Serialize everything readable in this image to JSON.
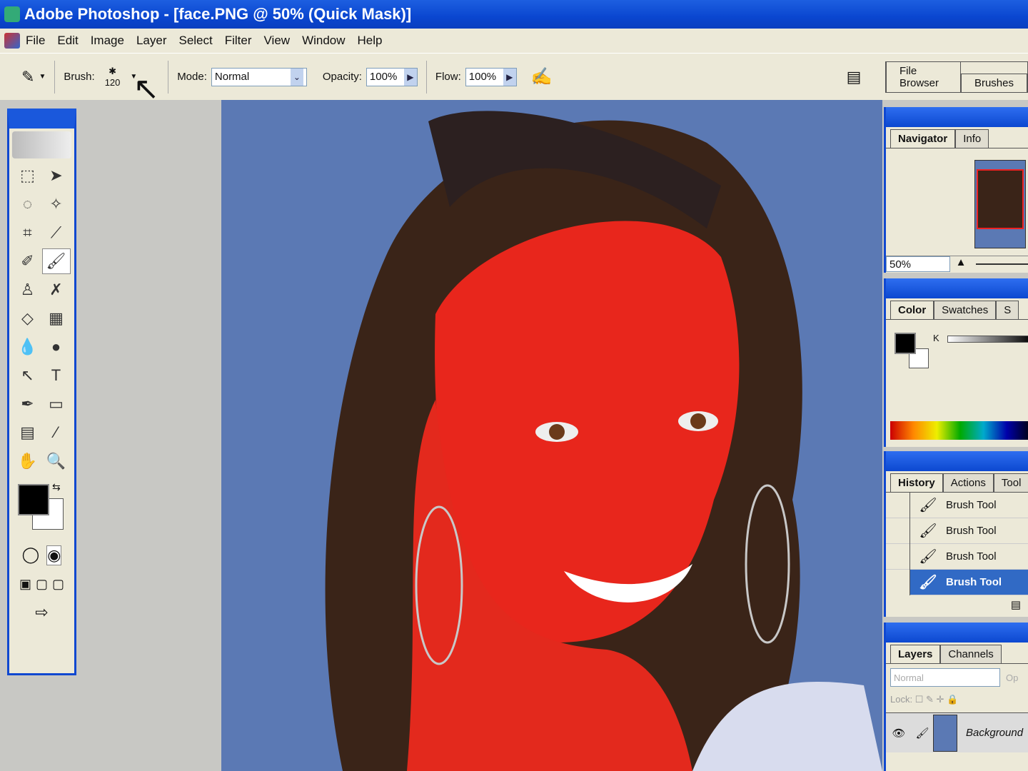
{
  "window": {
    "title": "Adobe Photoshop - [face.PNG @ 50% (Quick Mask)]"
  },
  "menu": [
    "File",
    "Edit",
    "Image",
    "Layer",
    "Select",
    "Filter",
    "View",
    "Window",
    "Help"
  ],
  "options": {
    "brush_label": "Brush:",
    "brush_size": "120",
    "mode_label": "Mode:",
    "mode_value": "Normal",
    "opacity_label": "Opacity:",
    "opacity_value": "100%",
    "flow_label": "Flow:",
    "flow_value": "100%"
  },
  "palette_well": {
    "tabs": [
      "File Browser",
      "Brushes"
    ]
  },
  "navigator": {
    "tabs": [
      "Navigator",
      "Info"
    ],
    "zoom": "50%"
  },
  "color": {
    "tabs": [
      "Color",
      "Swatches",
      "S"
    ],
    "channel": "K",
    "foreground": "#000000",
    "background": "#ffffff"
  },
  "history": {
    "tabs": [
      "History",
      "Actions",
      "Tool"
    ],
    "items": [
      "Brush Tool",
      "Brush Tool",
      "Brush Tool",
      "Brush Tool"
    ],
    "selected_index": 3
  },
  "layers": {
    "tabs": [
      "Layers",
      "Channels"
    ],
    "blend": "Normal",
    "opacity_label": "Op",
    "lock_label": "Lock:",
    "layer_name": "Background"
  },
  "canvas": {
    "mask_color": "#e8261c",
    "bg_color": "#5b79b4"
  }
}
